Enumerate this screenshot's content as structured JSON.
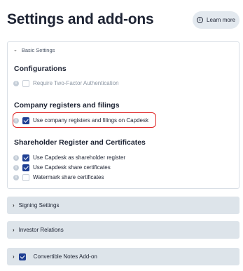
{
  "header": {
    "title": "Settings and add-ons",
    "learn_more_label": "Learn more",
    "learn_more_icon": "i"
  },
  "basic_settings": {
    "label": "Basic Settings",
    "sections": {
      "configurations": {
        "title": "Configurations",
        "items": [
          {
            "label": "Require Two-Factor Authentication",
            "checked": false,
            "disabled": true
          }
        ]
      },
      "company_registers": {
        "title": "Company registers and filings",
        "items": [
          {
            "label": "Use company registers and filings on Capdesk",
            "checked": true,
            "highlighted": true
          }
        ]
      },
      "shareholder_register": {
        "title": "Shareholder Register and Certificates",
        "items": [
          {
            "label": "Use Capdesk as shareholder register",
            "checked": true
          },
          {
            "label": "Use Capdesk share certificates",
            "checked": true
          },
          {
            "label": "Watermark share certificates",
            "checked": false
          }
        ]
      }
    }
  },
  "collapsed_panels": [
    {
      "label": "Signing Settings",
      "has_checkbox": false
    },
    {
      "label": "Investor Relations",
      "has_checkbox": false
    },
    {
      "label": "Convertible Notes Add-on",
      "has_checkbox": true,
      "checked": true
    }
  ],
  "colors": {
    "checkbox_checked": "#1f3f93",
    "highlight_border": "#e02424",
    "collapsed_bg": "#dde4ea"
  }
}
